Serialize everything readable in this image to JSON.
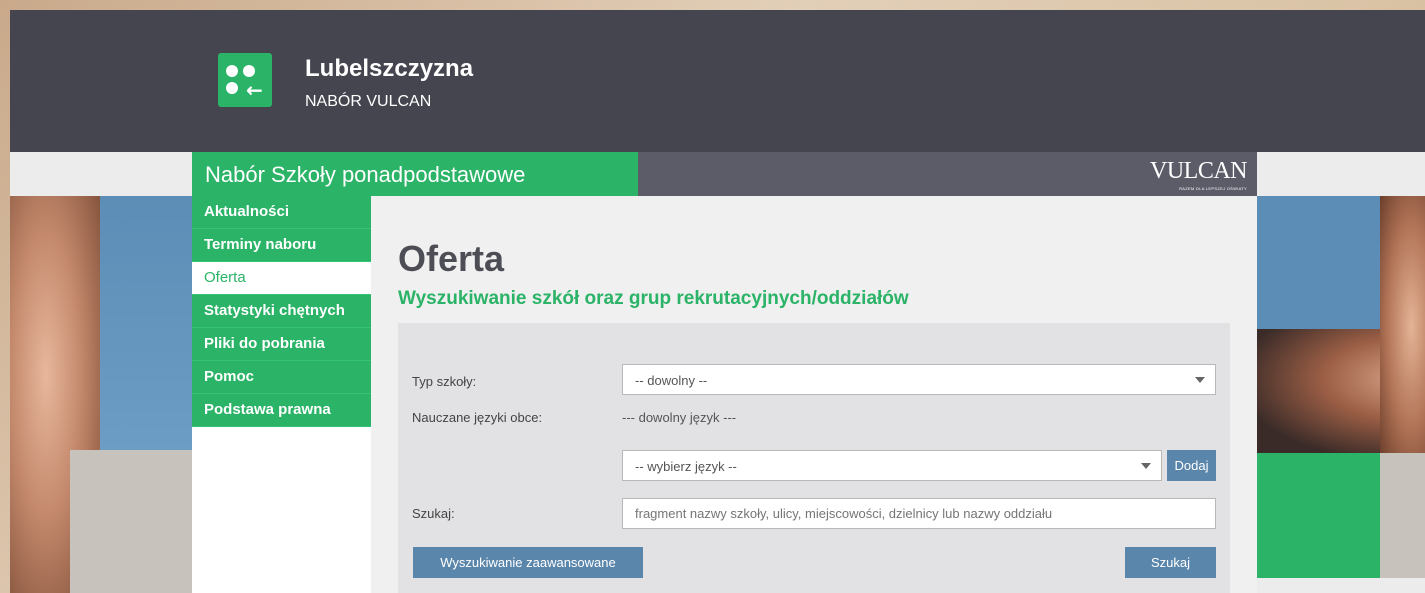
{
  "header": {
    "brand_title": "Lubelszczyzna",
    "brand_subtitle": "NABÓR VULCAN",
    "logo_icon": "people-arrow-icon"
  },
  "section_bar": {
    "title": "Nabór Szkoły ponadpodstawowe",
    "vulcan_logo": "VULCAN",
    "vulcan_tagline": "RAZEM DLA LEPSZEJ OŚWIATY"
  },
  "sidebar": {
    "items": [
      {
        "label": "Aktualności",
        "active": false
      },
      {
        "label": "Terminy naboru",
        "active": false
      },
      {
        "label": "Oferta",
        "active": true
      },
      {
        "label": "Statystyki chętnych",
        "active": false
      },
      {
        "label": "Pliki do pobrania",
        "active": false
      },
      {
        "label": "Pomoc",
        "active": false
      },
      {
        "label": "Podstawa prawna",
        "active": false
      }
    ]
  },
  "main": {
    "title": "Oferta",
    "subtitle": "Wyszukiwanie szkół oraz grup rekrutacyjnych/oddziałów"
  },
  "form": {
    "school_type_label": "Typ szkoły:",
    "school_type_value": "-- dowolny --",
    "languages_label": "Nauczane języki obce:",
    "languages_value": "--- dowolny język ---",
    "language_select_value": "-- wybierz język --",
    "add_button": "Dodaj",
    "search_label": "Szukaj:",
    "search_placeholder": "fragment nazwy szkoły, ulicy, miejscowości, dzielnicy lub nazwy oddziału",
    "advanced_search_button": "Wyszukiwanie zaawansowane",
    "search_button": "Szukaj"
  },
  "colors": {
    "brand_green": "#2bb367",
    "header_dark": "#45454f",
    "button_blue": "#5b86ac"
  }
}
